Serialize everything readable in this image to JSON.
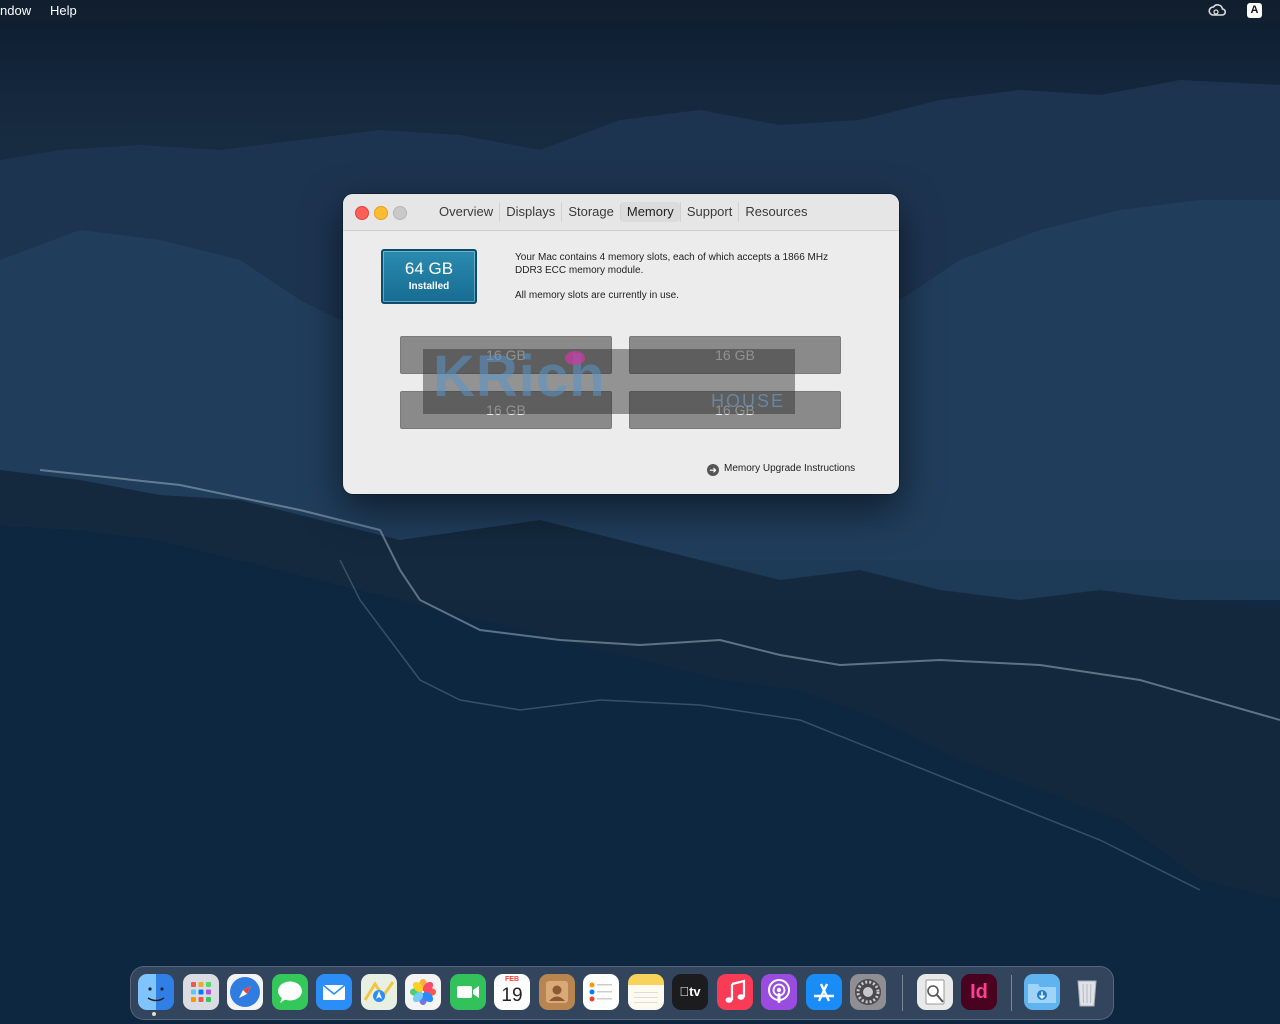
{
  "menubar": {
    "items": [
      "ndow",
      "Help"
    ],
    "status_icons": [
      "creative-cloud-icon",
      "input-source-icon"
    ],
    "input_source": "A"
  },
  "window": {
    "tabs": [
      "Overview",
      "Displays",
      "Storage",
      "Memory",
      "Support",
      "Resources"
    ],
    "active_tab": "Memory",
    "memory_badge": {
      "capacity": "64 GB",
      "label": "Installed"
    },
    "description": {
      "line1": "Your Mac contains 4 memory slots, each of which accepts a 1866 MHz DDR3 ECC memory module.",
      "line2": "All memory slots are currently in use."
    },
    "slots": [
      "16 GB",
      "16 GB",
      "16 GB",
      "16 GB"
    ],
    "watermark": {
      "text": "KRich",
      "sub": "HOUSE"
    },
    "upgrade_link": "Memory Upgrade Instructions"
  },
  "dock": {
    "apps": [
      {
        "name": "Finder",
        "icon": "finder-icon",
        "color": "#3d8ef0"
      },
      {
        "name": "Launchpad",
        "icon": "launchpad-icon",
        "color": "#d9dde3"
      },
      {
        "name": "Safari",
        "icon": "safari-icon",
        "color": "#2f7de1"
      },
      {
        "name": "Messages",
        "icon": "messages-icon",
        "color": "#34c759"
      },
      {
        "name": "Mail",
        "icon": "mail-icon",
        "color": "#2b8ef6"
      },
      {
        "name": "Maps",
        "icon": "maps-icon",
        "color": "#5ab866"
      },
      {
        "name": "Photos",
        "icon": "photos-icon",
        "color": "#f4f4f4"
      },
      {
        "name": "FaceTime",
        "icon": "facetime-icon",
        "color": "#32c15a"
      },
      {
        "name": "Calendar",
        "icon": "calendar-icon",
        "color": "#ffffff"
      },
      {
        "name": "Contacts",
        "icon": "contacts-icon",
        "color": "#b88551"
      },
      {
        "name": "Reminders",
        "icon": "reminders-icon",
        "color": "#ffffff"
      },
      {
        "name": "Notes",
        "icon": "notes-icon",
        "color": "#f7d35a"
      },
      {
        "name": "TV",
        "icon": "tv-icon",
        "color": "#1c1c1e"
      },
      {
        "name": "Music",
        "icon": "music-icon",
        "color": "#f93b55"
      },
      {
        "name": "Podcasts",
        "icon": "podcasts-icon",
        "color": "#9a4ce0"
      },
      {
        "name": "App Store",
        "icon": "app-store-icon",
        "color": "#1a8cf5"
      },
      {
        "name": "System Preferences",
        "icon": "system-preferences-icon",
        "color": "#8e8e93"
      },
      {
        "name": "Preview",
        "icon": "preview-icon",
        "color": "#e9e9e9"
      },
      {
        "name": "InDesign",
        "icon": "indesign-icon",
        "color": "#49021f"
      },
      {
        "name": "Downloads",
        "icon": "downloads-folder-icon",
        "color": "#5fb3ee"
      },
      {
        "name": "Trash",
        "icon": "trash-icon",
        "color": "#cfd3d8"
      }
    ],
    "calendar": {
      "month": "FEB",
      "day": "19"
    },
    "tv_label": "tv",
    "indesign_label": "Id"
  }
}
